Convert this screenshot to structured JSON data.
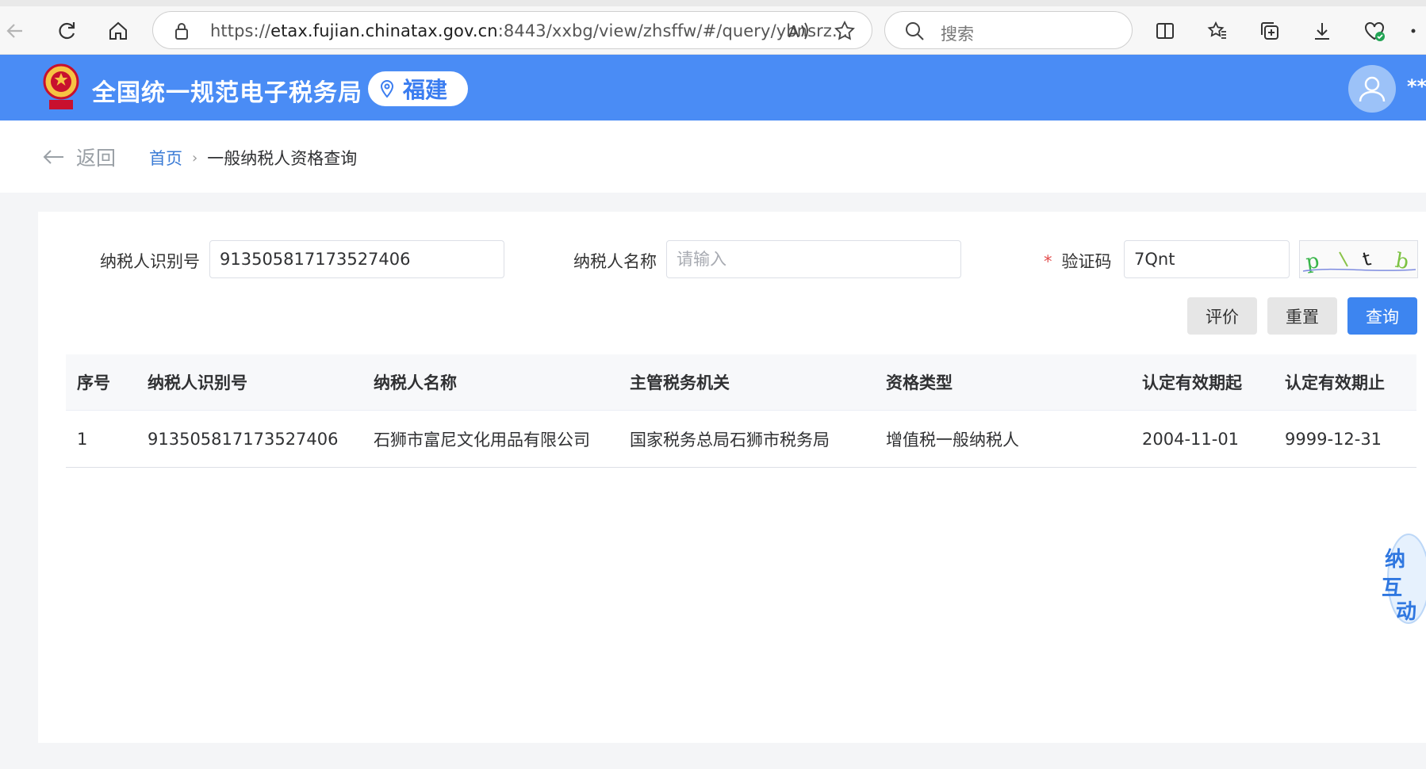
{
  "browser": {
    "url_prefix": "https://",
    "url_host": "etax.fujian.chinatax.gov.cn",
    "url_rest": ":8443/xxbg/view/zhsffw/#/query/ybnsrz...",
    "search_placeholder": "搜索"
  },
  "header": {
    "site_title": "全国统一规范电子税务局",
    "region": "福建",
    "user_masked": "**"
  },
  "breadcrumb": {
    "back_label": "返回",
    "home": "首页",
    "separator": "›",
    "current": "一般纳税人资格查询"
  },
  "form": {
    "taxpayer_id_label": "纳税人识别号",
    "taxpayer_id_value": "913505817173527406",
    "taxpayer_name_label": "纳税人名称",
    "taxpayer_name_placeholder": "请输入",
    "required_mark": "*",
    "captcha_label": "验证码",
    "captcha_value": "7Qnt"
  },
  "buttons": {
    "evaluate": "评价",
    "reset": "重置",
    "query": "查询"
  },
  "table": {
    "columns": [
      "序号",
      "纳税人识别号",
      "纳税人名称",
      "主管税务机关",
      "资格类型",
      "认定有效期起",
      "认定有效期止"
    ],
    "rows": [
      [
        "1",
        "913505817173527406",
        "石狮市富尼文化用品有限公司",
        "国家税务总局石狮市税务局",
        "增值税一般纳税人",
        "2004-11-01",
        "9999-12-31"
      ]
    ]
  },
  "float_widget": {
    "text": "纳税互动"
  },
  "colors": {
    "header_blue": "#4a8cf5",
    "primary_button": "#3d85f0",
    "link_blue": "#3a7bd5"
  }
}
